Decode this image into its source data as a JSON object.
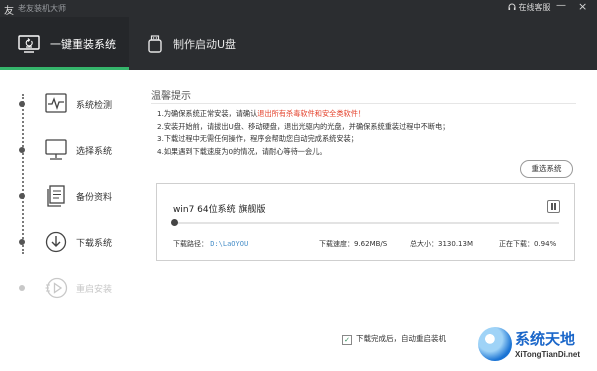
{
  "app": {
    "title": "老友装机大师",
    "logo": "友"
  },
  "titlebar": {
    "service": "在线客服",
    "minimize": "—",
    "close": "×"
  },
  "tabs": [
    {
      "label": "一键重装系统",
      "active": true
    },
    {
      "label": "制作启动U盘",
      "active": false
    }
  ],
  "steps": [
    {
      "label": "系统检测",
      "icon": "pulse-icon"
    },
    {
      "label": "选择系统",
      "icon": "monitor-icon"
    },
    {
      "label": "备份资料",
      "icon": "document-icon"
    },
    {
      "label": "下载系统",
      "icon": "download-icon"
    },
    {
      "label": "重启安装",
      "icon": "play-icon",
      "disabled": true
    }
  ],
  "main": {
    "title": "温馨提示",
    "tip1_pre": "1.为确保系统正常安装，请确认",
    "tip1_red": "退出所有杀毒软件和安全类软件！",
    "tip2": "2.安装开始前，请拔出U盘、移动硬盘，退出光驱内的光盘，并确保系统重装过程中不断电；",
    "tip3": "3.下载过程中无需任何操作，程序会帮助您自动完成系统安装；",
    "tip4": "4.如果遇到下载速度为0的情况，请耐心等待一会儿。",
    "reselect": "重选系统"
  },
  "download": {
    "system_name": "win7 64位系统 旗舰版",
    "progress_percent": 0.94,
    "path_label": "下载路径：",
    "path_value": "D:\\LaOYOU",
    "speed": "下载速度：9.62MB/S",
    "size": "总大小：3130.13M",
    "status": "正在下载：0.94%"
  },
  "footer": {
    "auto_restart": "下载完成后，自动重启装机",
    "checked": true
  },
  "watermark": {
    "title": "系统天地",
    "url": "XiTongTianDi.net"
  },
  "colors": {
    "accent": "#35b56b",
    "dark": "#2b2d30",
    "warn": "#e4402a",
    "link": "#4a90c9"
  }
}
